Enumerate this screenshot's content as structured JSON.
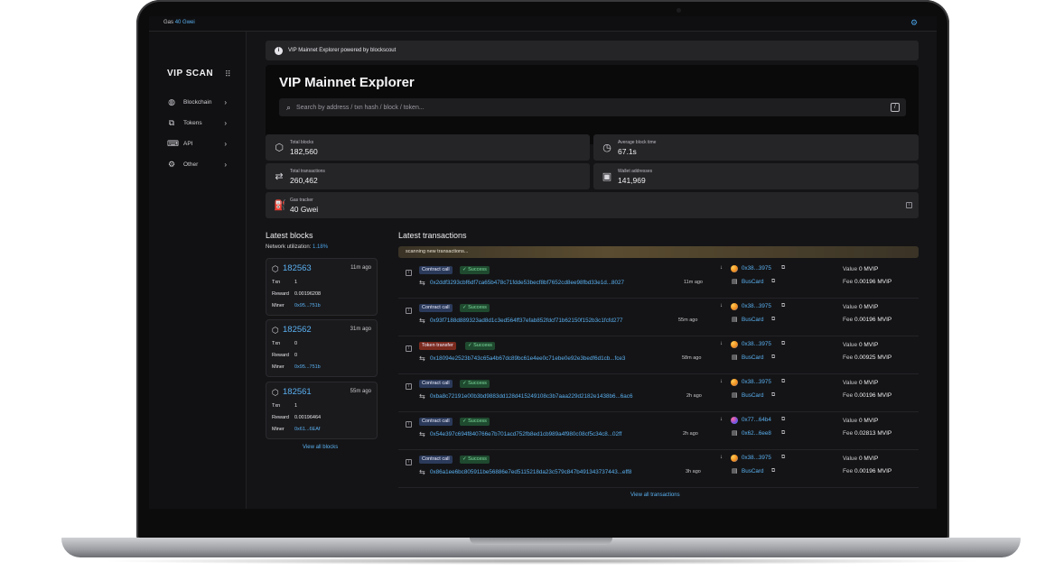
{
  "topbar": {
    "gas_label": "Gas",
    "gas_value": "40 Gwei"
  },
  "sidebar": {
    "logo": "VIP SCAN",
    "items": [
      {
        "label": "Blockchain",
        "icon": "globe-icon"
      },
      {
        "label": "Tokens",
        "icon": "tokens-icon"
      },
      {
        "label": "API",
        "icon": "api-icon"
      },
      {
        "label": "Other",
        "icon": "gear-icon"
      }
    ]
  },
  "banner": {
    "text": "VIP Mainnet Explorer powered by blockscout"
  },
  "hero": {
    "title": "VIP Mainnet Explorer",
    "search_placeholder": "Search by address / txn hash / block / token...",
    "shortcut": "/"
  },
  "stats": {
    "total_blocks": {
      "label": "Total blocks",
      "value": "182,560"
    },
    "avg_block_time": {
      "label": "Average block time",
      "value": "67.1s"
    },
    "total_transactions": {
      "label": "Total transactions",
      "value": "260,462"
    },
    "wallet_addresses": {
      "label": "Wallet addresses",
      "value": "141,969"
    },
    "gas_tracker": {
      "label": "Gas tracker",
      "value": "40 Gwei"
    }
  },
  "latest_blocks": {
    "title": "Latest blocks",
    "utilization_label": "Network utilization:",
    "utilization_value": "1.18%",
    "labels": {
      "txn": "Txn",
      "reward": "Reward",
      "miner": "Miner"
    },
    "blocks": [
      {
        "number": "182563",
        "age": "11m ago",
        "txn": "1",
        "reward": "0.00196208",
        "miner": "0x95...751b"
      },
      {
        "number": "182562",
        "age": "31m ago",
        "txn": "0",
        "reward": "0",
        "miner": "0x95...751b"
      },
      {
        "number": "182561",
        "age": "55m ago",
        "txn": "1",
        "reward": "0.00196464",
        "miner": "0x61...6EAf"
      }
    ],
    "view_all": "View all blocks"
  },
  "latest_transactions": {
    "title": "Latest transactions",
    "scanning": "scanning new transactions...",
    "value_label": "Value",
    "fee_label": "Fee",
    "rows": [
      {
        "type": "Contract call",
        "status": "Success",
        "hash": "0x2ddf3293cbf6df7ca65b478c71fdde53becf8bf7652cd8ee98fbd33e1d...8027",
        "age": "11m ago",
        "from": "0x38...3975",
        "to": "BusCard",
        "value": "0 MVIP",
        "fee": "0.00196 MVIP"
      },
      {
        "type": "Contract call",
        "status": "Success",
        "hash": "0x93f7188d889323ad8d1c3ed564ff37efab852fdcf71b62150f152b3c1fcfd277",
        "age": "55m ago",
        "from": "0x38...3975",
        "to": "BusCard",
        "value": "0 MVIP",
        "fee": "0.00196 MVIP"
      },
      {
        "type": "Token transfer",
        "status": "Success",
        "hash": "0x18094e2523b743c65a4b67dc89bc61e4ee0c71ebe0e92e3bedf6d1cb...fce3",
        "age": "58m ago",
        "from": "0x38...3975",
        "to": "BusCard",
        "value": "0 MVIP",
        "fee": "0.00925 MVIP"
      },
      {
        "type": "Contract call",
        "status": "Success",
        "hash": "0xba8c72191e00b3bd9883dd128d415249108c3b7aaa229d2182e1438b6...6ac6",
        "age": "2h ago",
        "from": "0x38...3975",
        "to": "BusCard",
        "value": "0 MVIP",
        "fee": "0.00196 MVIP"
      },
      {
        "type": "Contract call",
        "status": "Success",
        "hash": "0x54e397c694f840766e7b701acd752fb8ed1cb989a4f980c08cf5c34c8...02ff",
        "age": "2h ago",
        "from": "0x77...64b4",
        "to": "0x62...6ee8",
        "value": "0 MVIP",
        "fee": "0.02813 MVIP"
      },
      {
        "type": "Contract call",
        "status": "Success",
        "hash": "0x86a1ee6bc805911be56886e7ed5115218da23c579c847b491343737443...eff8",
        "age": "3h ago",
        "from": "0x38...3975",
        "to": "BusCard",
        "value": "0 MVIP",
        "fee": "0.00196 MVIP"
      }
    ],
    "view_all": "View all transactions"
  }
}
